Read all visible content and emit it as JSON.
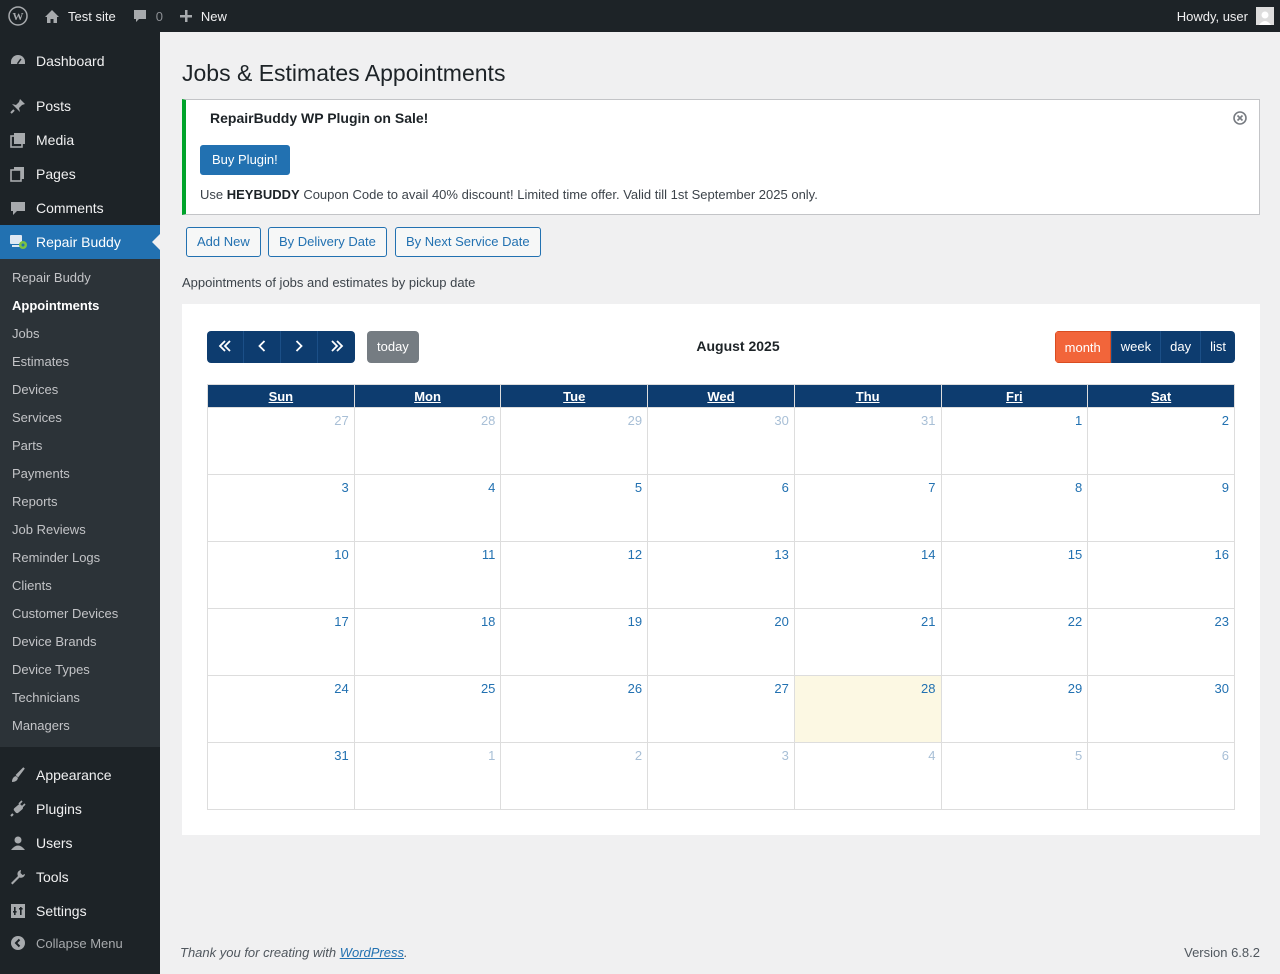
{
  "adminbar": {
    "site_name": "Test site",
    "comments_count": "0",
    "new_label": "New",
    "howdy": "Howdy, user"
  },
  "sidebar": {
    "top_items": [
      {
        "label": "Dashboard",
        "icon": "dashboard-icon"
      },
      {
        "label": "Posts",
        "icon": "pin-icon"
      },
      {
        "label": "Media",
        "icon": "media-icon"
      },
      {
        "label": "Pages",
        "icon": "pages-icon"
      },
      {
        "label": "Comments",
        "icon": "comment-icon"
      },
      {
        "label": "Repair Buddy",
        "icon": "repair-buddy-icon"
      }
    ],
    "submenu": [
      "Repair Buddy",
      "Appointments",
      "Jobs",
      "Estimates",
      "Devices",
      "Services",
      "Parts",
      "Payments",
      "Reports",
      "Job Reviews",
      "Reminder Logs",
      "Clients",
      "Customer Devices",
      "Device Brands",
      "Device Types",
      "Technicians",
      "Managers"
    ],
    "active_submenu": "Appointments",
    "bottom_items": [
      {
        "label": "Appearance",
        "icon": "brush-icon"
      },
      {
        "label": "Plugins",
        "icon": "plug-icon"
      },
      {
        "label": "Users",
        "icon": "user-icon"
      },
      {
        "label": "Tools",
        "icon": "wrench-icon"
      },
      {
        "label": "Settings",
        "icon": "settings-icon"
      }
    ],
    "collapse_label": "Collapse Menu"
  },
  "page": {
    "title": "Jobs & Estimates Appointments",
    "subtitle": "Appointments of jobs and estimates by pickup date"
  },
  "notice": {
    "title": "RepairBuddy WP Plugin on Sale!",
    "button": "Buy Plugin!",
    "text_prefix": "Use ",
    "coupon": "HEYBUDDY",
    "text_suffix": " Coupon Code to avail 40% discount! Limited time offer. Valid till 1st September 2025 only."
  },
  "actions": {
    "add_new": "Add New",
    "by_delivery": "By Delivery Date",
    "by_next_service": "By Next Service Date"
  },
  "calendar": {
    "title": "August 2025",
    "today_label": "today",
    "views": [
      "month",
      "week",
      "day",
      "list"
    ],
    "active_view": "month",
    "weekdays": [
      "Sun",
      "Mon",
      "Tue",
      "Wed",
      "Thu",
      "Fri",
      "Sat"
    ],
    "weeks": [
      [
        {
          "d": "27",
          "o": true
        },
        {
          "d": "28",
          "o": true
        },
        {
          "d": "29",
          "o": true
        },
        {
          "d": "30",
          "o": true
        },
        {
          "d": "31",
          "o": true
        },
        {
          "d": "1"
        },
        {
          "d": "2"
        }
      ],
      [
        {
          "d": "3"
        },
        {
          "d": "4"
        },
        {
          "d": "5"
        },
        {
          "d": "6"
        },
        {
          "d": "7"
        },
        {
          "d": "8"
        },
        {
          "d": "9"
        }
      ],
      [
        {
          "d": "10"
        },
        {
          "d": "11"
        },
        {
          "d": "12"
        },
        {
          "d": "13"
        },
        {
          "d": "14"
        },
        {
          "d": "15"
        },
        {
          "d": "16"
        }
      ],
      [
        {
          "d": "17"
        },
        {
          "d": "18"
        },
        {
          "d": "19"
        },
        {
          "d": "20"
        },
        {
          "d": "21"
        },
        {
          "d": "22"
        },
        {
          "d": "23"
        }
      ],
      [
        {
          "d": "24"
        },
        {
          "d": "25"
        },
        {
          "d": "26"
        },
        {
          "d": "27"
        },
        {
          "d": "28",
          "t": true
        },
        {
          "d": "29"
        },
        {
          "d": "30"
        }
      ],
      [
        {
          "d": "31"
        },
        {
          "d": "1",
          "o": true
        },
        {
          "d": "2",
          "o": true
        },
        {
          "d": "3",
          "o": true
        },
        {
          "d": "4",
          "o": true
        },
        {
          "d": "5",
          "o": true
        },
        {
          "d": "6",
          "o": true
        }
      ]
    ]
  },
  "footer": {
    "thanks_prefix": "Thank you for creating with ",
    "wp_link": "WordPress",
    "thanks_suffix": ".",
    "version": "Version 6.8.2"
  },
  "colors": {
    "admin_dark": "#1d2327",
    "accent_blue": "#2271b1",
    "calendar_navy": "#0d3c6f",
    "active_orange": "#f2653a",
    "notice_green": "#00a32a",
    "today_bg": "#fcf8e3"
  }
}
